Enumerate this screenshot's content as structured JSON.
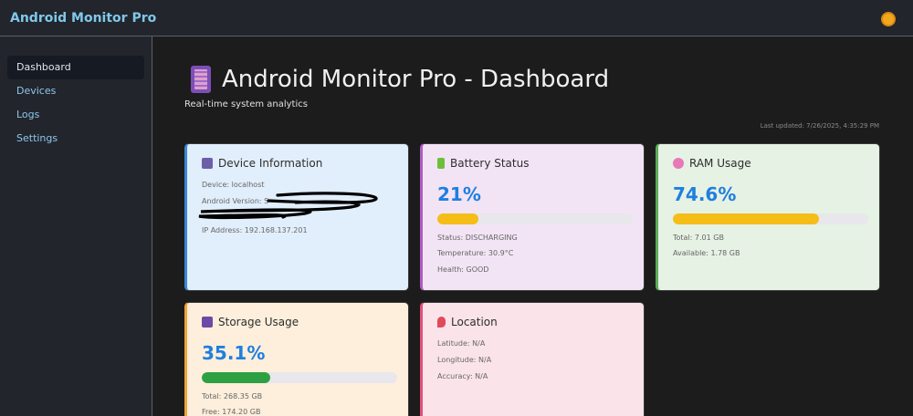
{
  "app": {
    "title": "Android Monitor Pro",
    "theme_icon": "sun-icon"
  },
  "sidebar": {
    "items": [
      {
        "label": "Dashboard",
        "active": true
      },
      {
        "label": "Devices",
        "active": false
      },
      {
        "label": "Logs",
        "active": false
      },
      {
        "label": "Settings",
        "active": false
      }
    ]
  },
  "page": {
    "title": "Android Monitor Pro - Dashboard",
    "subtitle": "Real-time system analytics",
    "last_updated": "Last updated: 7/26/2025, 4:35:29 PM"
  },
  "cards": {
    "device": {
      "title": "Device Information",
      "device": "Device: localhost",
      "android_version": "Android Version: S",
      "ip": "IP Address: 192.168.137.201"
    },
    "battery": {
      "title": "Battery Status",
      "percent_text": "21%",
      "percent": 21,
      "bar_color": "#f5bd17",
      "status": "Status: DISCHARGING",
      "temperature": "Temperature: 30.9°C",
      "health": "Health: GOOD"
    },
    "ram": {
      "title": "RAM Usage",
      "percent_text": "74.6%",
      "percent": 74.6,
      "bar_color": "#f5bd17",
      "total": "Total: 7.01 GB",
      "available": "Available: 1.78 GB"
    },
    "storage": {
      "title": "Storage Usage",
      "percent_text": "35.1%",
      "percent": 35.1,
      "bar_color": "#2ea044",
      "total": "Total: 268.35 GB",
      "free": "Free: 174.20 GB"
    },
    "location": {
      "title": "Location",
      "latitude": "Latitude: N/A",
      "longitude": "Longitude: N/A",
      "accuracy": "Accuracy: N/A"
    }
  },
  "colors": {
    "accent": "#1f7fe0",
    "nav_link": "#8fc6ec",
    "brand": "#7fc8ea"
  }
}
